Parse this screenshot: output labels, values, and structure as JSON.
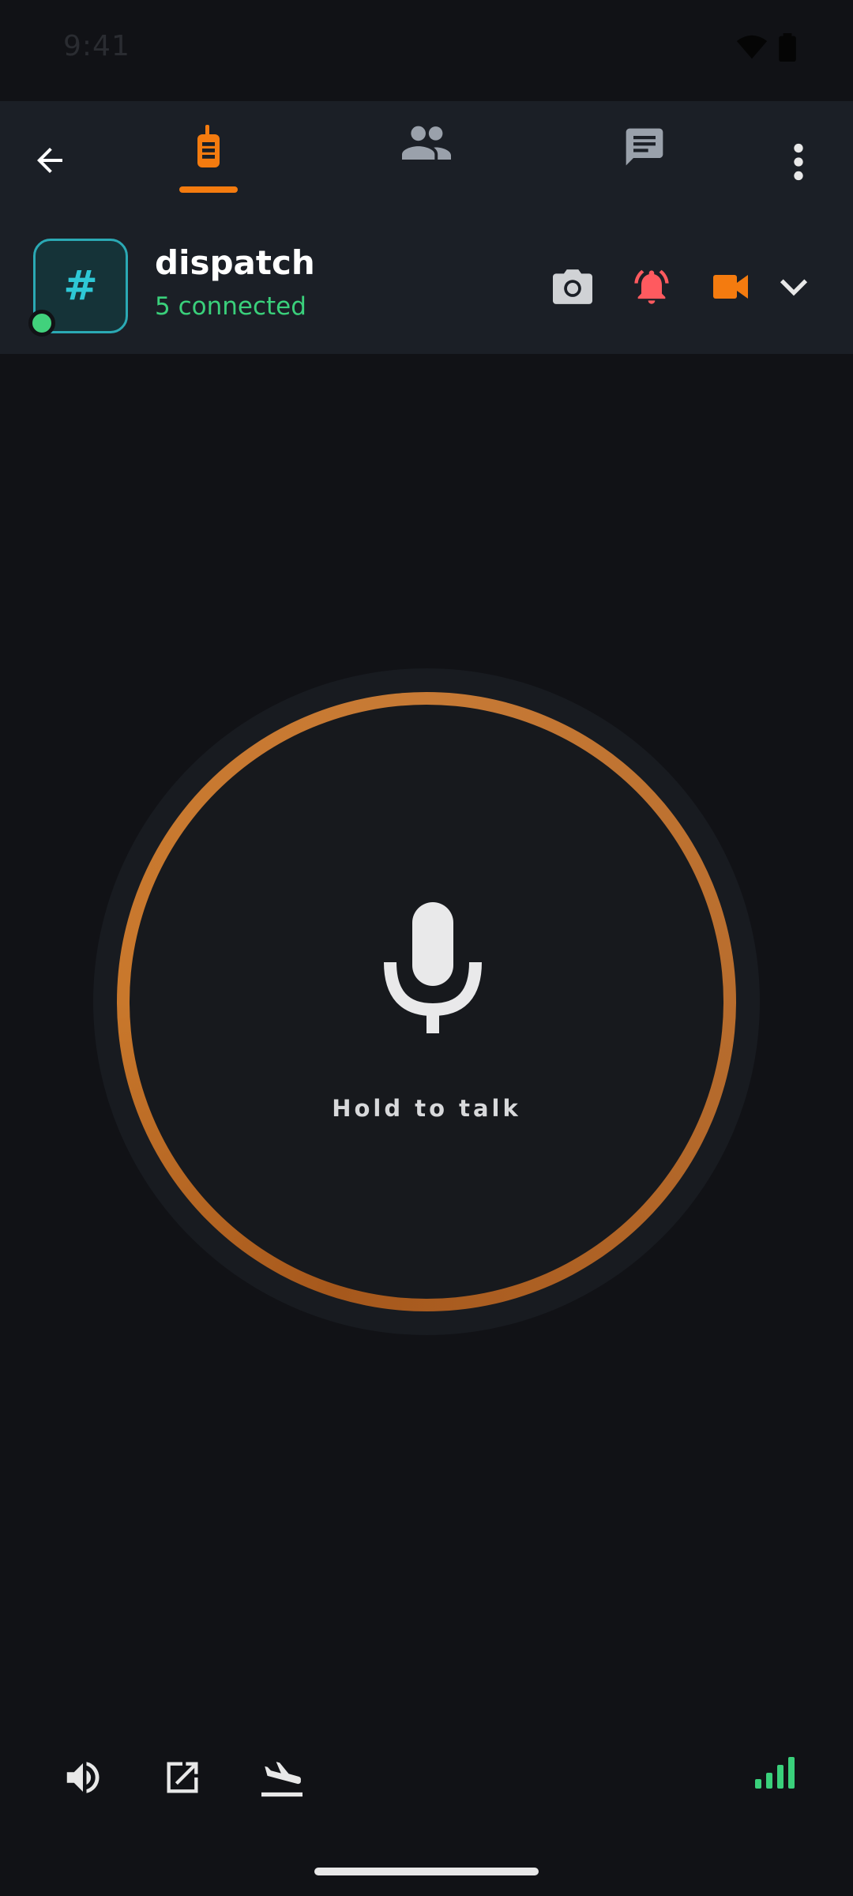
{
  "status_bar": {
    "time": "9:41"
  },
  "tabs": [
    {
      "id": "radio",
      "icon": "walkie-talkie-icon",
      "active": true
    },
    {
      "id": "members",
      "icon": "people-icon",
      "active": false
    },
    {
      "id": "chat",
      "icon": "chat-icon",
      "active": false
    }
  ],
  "channel": {
    "avatar_symbol": "#",
    "name": "dispatch",
    "status": "5 connected",
    "online": true
  },
  "ptt": {
    "label": "Hold to talk"
  },
  "colors": {
    "accent": "#f47b0f",
    "online": "#41d17c",
    "alert": "#ff5a5f",
    "channel_teal": "#2ec8d6",
    "background": "#111216",
    "header": "#1b1f26"
  },
  "bottom_icons": [
    "speaker-icon",
    "popout-icon",
    "airplane-icon",
    "signal-strength-icon"
  ]
}
